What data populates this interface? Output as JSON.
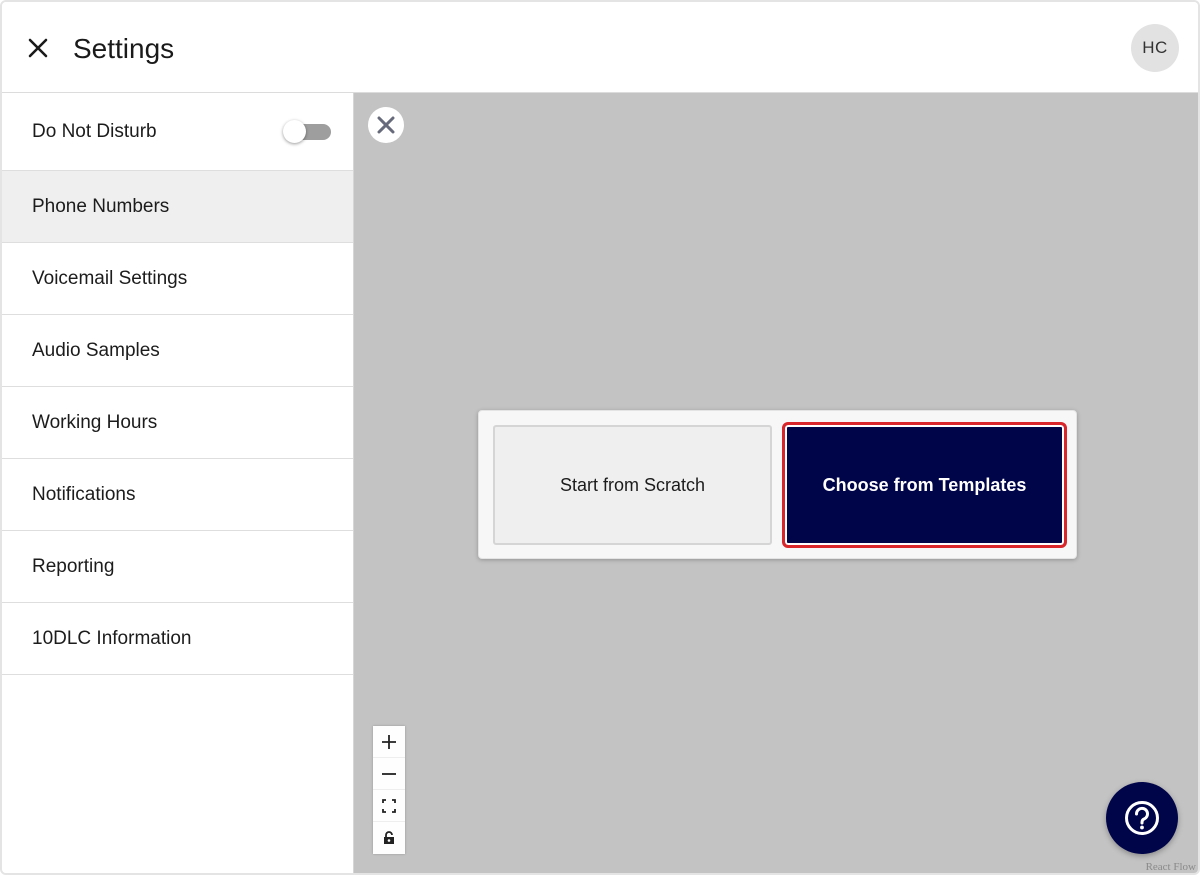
{
  "header": {
    "title": "Settings",
    "close_icon": "close-icon",
    "avatar_initials": "HC"
  },
  "sidebar": {
    "items": [
      {
        "label": "Do Not Disturb",
        "toggle": false
      },
      {
        "label": "Phone Numbers",
        "active": true
      },
      {
        "label": "Voicemail Settings"
      },
      {
        "label": "Audio Samples"
      },
      {
        "label": "Working Hours"
      },
      {
        "label": "Notifications"
      },
      {
        "label": "Reporting"
      },
      {
        "label": "10DLC Information"
      }
    ]
  },
  "canvas": {
    "close_icon": "close-icon",
    "choice": {
      "scratch_label": "Start from Scratch",
      "templates_label": "Choose from Templates"
    },
    "controls": [
      "zoom-in-icon",
      "zoom-out-icon",
      "fit-view-icon",
      "lock-icon"
    ],
    "attribution": "React Flow",
    "help_icon": "help-icon"
  },
  "colors": {
    "brand_navy": "#000449",
    "highlight_red": "#d9262b",
    "canvas_bg": "#c3c3c3",
    "active_item_bg": "#efefef"
  }
}
